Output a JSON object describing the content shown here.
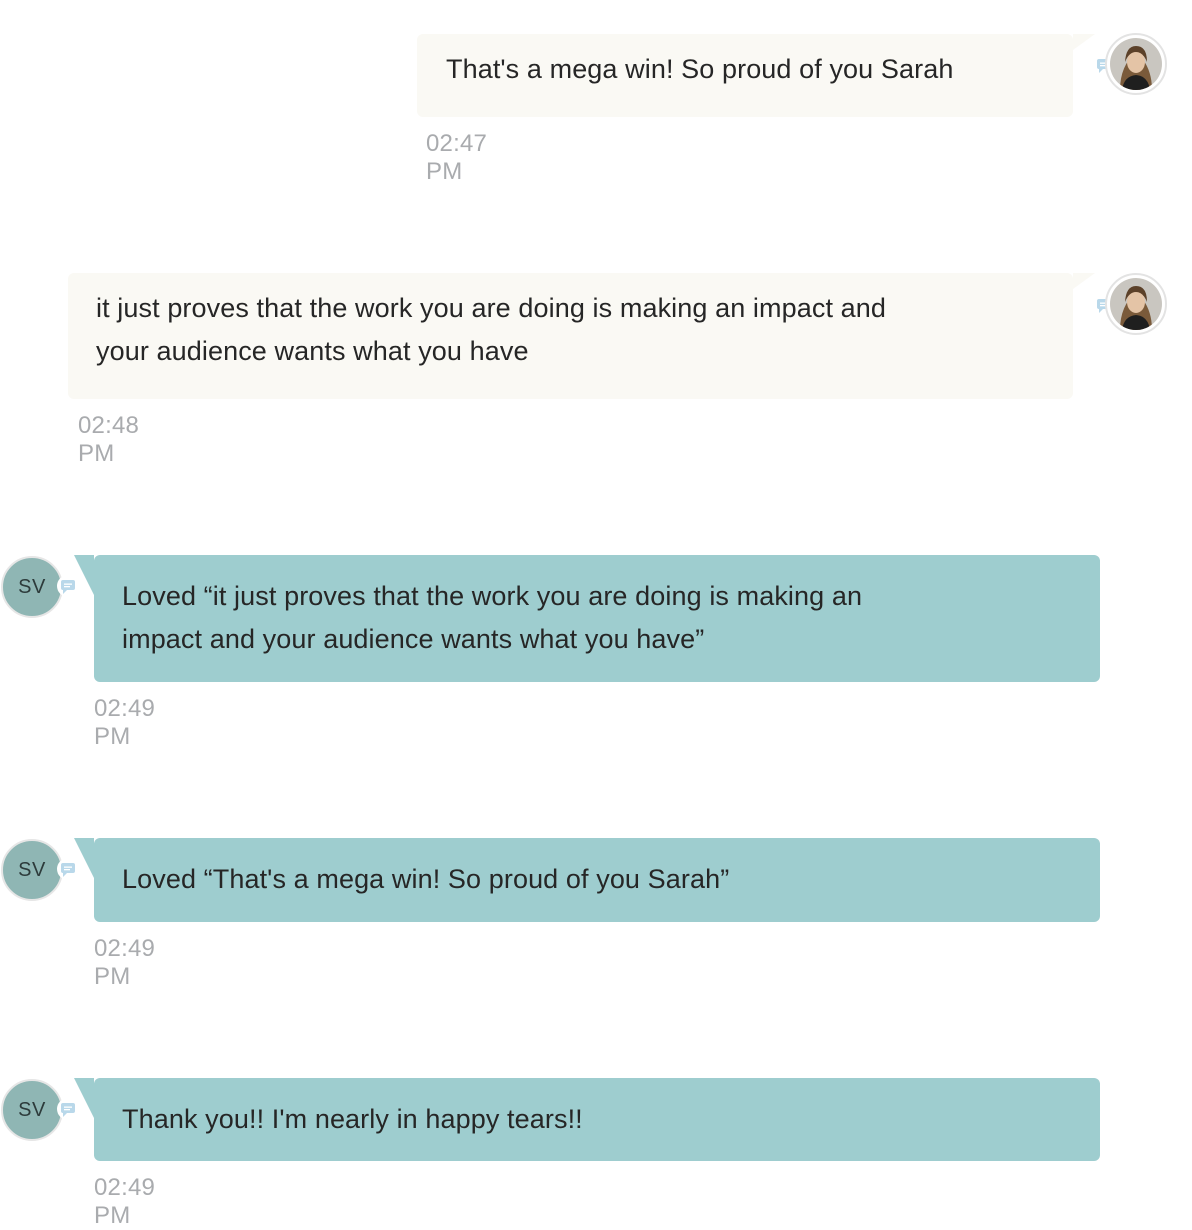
{
  "conversation": {
    "messages": [
      {
        "direction": "outgoing",
        "text_lines": [
          "That's a mega win! So proud of you Sarah"
        ],
        "time": "02:47 PM",
        "avatar": {
          "type": "photo",
          "icon": "user-photo"
        },
        "channel_icon": "sms-icon"
      },
      {
        "direction": "outgoing",
        "text_lines": [
          "it just proves that the work you are doing is making an impact and",
          "your audience wants what you have"
        ],
        "time": "02:48 PM",
        "avatar": {
          "type": "photo",
          "icon": "user-photo"
        },
        "channel_icon": "sms-icon"
      },
      {
        "direction": "incoming",
        "text_lines": [
          "Loved “it just proves that the work you are doing is making an",
          "impact and your audience wants what you have”"
        ],
        "time": "02:49 PM",
        "avatar": {
          "type": "initials",
          "initials": "SV"
        },
        "channel_icon": "sms-icon"
      },
      {
        "direction": "incoming",
        "text_lines": [
          "Loved “That's a mega win! So proud of you Sarah”"
        ],
        "time": "02:49 PM",
        "avatar": {
          "type": "initials",
          "initials": "SV"
        },
        "channel_icon": "sms-icon"
      },
      {
        "direction": "incoming",
        "text_lines": [
          "Thank you!! I'm nearly in happy tears!!"
        ],
        "time": "02:49 PM",
        "avatar": {
          "type": "initials",
          "initials": "SV"
        },
        "channel_icon": "sms-icon"
      }
    ]
  },
  "colors": {
    "outgoing_bubble": "#faf9f4",
    "incoming_bubble": "#9ecdcf",
    "initials_avatar": "#8fb6b4",
    "timestamp": "#a9abae",
    "text": "#262626"
  }
}
